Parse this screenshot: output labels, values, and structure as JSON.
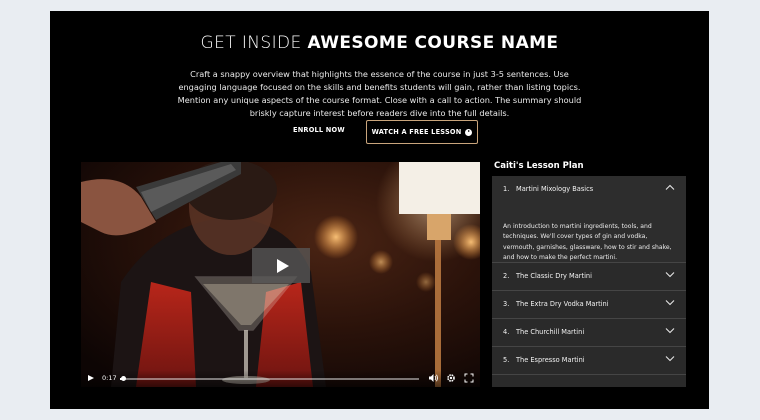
{
  "hero": {
    "title_light": "GET INSIDE",
    "title_bold": "AWESOME COURSE NAME",
    "summary": "Craft a snappy overview that highlights the essence of the course in just 3-5 sentences. Use engaging language focused on the skills and benefits students will gain, rather than listing topics. Mention any unique aspects of the course format. Close with a call to action. The summary should briskly capture interest before readers dive into the full details."
  },
  "cta": {
    "enroll_label": "ENROLL NOW",
    "watch_label": "WATCH A FREE LESSON"
  },
  "video": {
    "time": "0:17",
    "progress": 0.01,
    "icons": [
      "play-icon",
      "volume-icon",
      "settings-icon",
      "fullscreen-icon"
    ]
  },
  "lesson_plan": {
    "title": "Caiti's Lesson Plan",
    "items": [
      {
        "num": "1.",
        "title": "Martini Mixology Basics",
        "open": true,
        "description": "An introduction to martini ingredients, tools, and techniques. We'll cover types of gin and vodka, vermouth, garnishes, glassware, how to stir and shake, and how to make the perfect martini."
      },
      {
        "num": "2.",
        "title": "The Classic Dry Martini",
        "open": false
      },
      {
        "num": "3.",
        "title": "The Extra Dry Vodka Martini",
        "open": false
      },
      {
        "num": "4.",
        "title": "The Churchill Martini",
        "open": false
      },
      {
        "num": "5.",
        "title": "The Espresso Martini",
        "open": false
      }
    ]
  },
  "colors": {
    "page_bg": "#e9edf2",
    "frame_bg": "#000000",
    "accent_border": "#c9a57c",
    "panel_bg": "#2a2a2a"
  }
}
